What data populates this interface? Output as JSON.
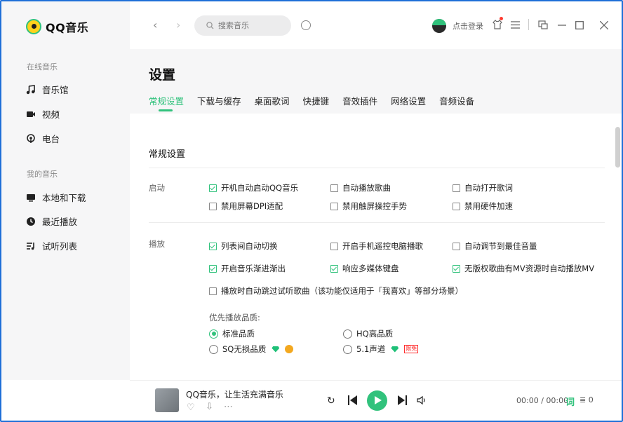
{
  "app": {
    "logo_text": "QQ音乐",
    "accent": "#31c27c"
  },
  "sidebar": {
    "online_title": "在线音乐",
    "online_items": [
      {
        "label": "音乐馆",
        "icon": "music-note-icon"
      },
      {
        "label": "视频",
        "icon": "video-icon"
      },
      {
        "label": "电台",
        "icon": "radio-icon"
      }
    ],
    "mine_title": "我的音乐",
    "mine_items": [
      {
        "label": "本地和下载",
        "icon": "computer-icon"
      },
      {
        "label": "最近播放",
        "icon": "clock-icon"
      },
      {
        "label": "试听列表",
        "icon": "playlist-icon"
      }
    ]
  },
  "topbar": {
    "search_placeholder": "搜索音乐",
    "login_label": "点击登录",
    "icons": [
      "back-icon",
      "forward-icon",
      "search-icon",
      "mic-icon",
      "avatar",
      "skin-icon",
      "menu-icon",
      "mini-mode-icon",
      "minimize-icon",
      "maximize-icon",
      "close-icon"
    ]
  },
  "header": {
    "title": "设置",
    "tabs": [
      "常规设置",
      "下载与缓存",
      "桌面歌词",
      "快捷键",
      "音效插件",
      "网络设置",
      "音频设备"
    ]
  },
  "settings": {
    "section_title": "常规设置",
    "startup_label": "启动",
    "startup": [
      {
        "label": "开机自动启动QQ音乐",
        "checked": true
      },
      {
        "label": "自动播放歌曲",
        "checked": false
      },
      {
        "label": "自动打开歌词",
        "checked": false
      },
      {
        "label": "禁用屏幕DPI适配",
        "checked": false
      },
      {
        "label": "禁用触屏操控手势",
        "checked": false
      },
      {
        "label": "禁用硬件加速",
        "checked": false
      }
    ],
    "play_label": "播放",
    "play": [
      {
        "label": "列表间自动切换",
        "checked": true
      },
      {
        "label": "开启手机遥控电脑播歌",
        "checked": false
      },
      {
        "label": "自动调节到最佳音量",
        "checked": false
      },
      {
        "label": "开启音乐渐进渐出",
        "checked": true
      },
      {
        "label": "响应多媒体键盘",
        "checked": true
      },
      {
        "label": "无版权歌曲有MV资源时自动播放MV",
        "checked": true
      },
      {
        "label": "播放时自动跳过试听歌曲（该功能仅适用于「我喜欢」等部分场景）",
        "checked": false
      }
    ],
    "quality_label": "优先播放品质:",
    "quality": [
      {
        "label": "标准品质",
        "selected": true
      },
      {
        "label": "HQ高品质",
        "selected": false
      },
      {
        "label": "SQ无损品质",
        "selected": false
      },
      {
        "label": "5.1声道",
        "selected": false
      }
    ],
    "limited_badge": "限免"
  },
  "player": {
    "song_title": "QQ音乐，让生活充满音乐",
    "time": "00:00 / 00:00",
    "lyric_label": "词",
    "queue_count": "0"
  }
}
